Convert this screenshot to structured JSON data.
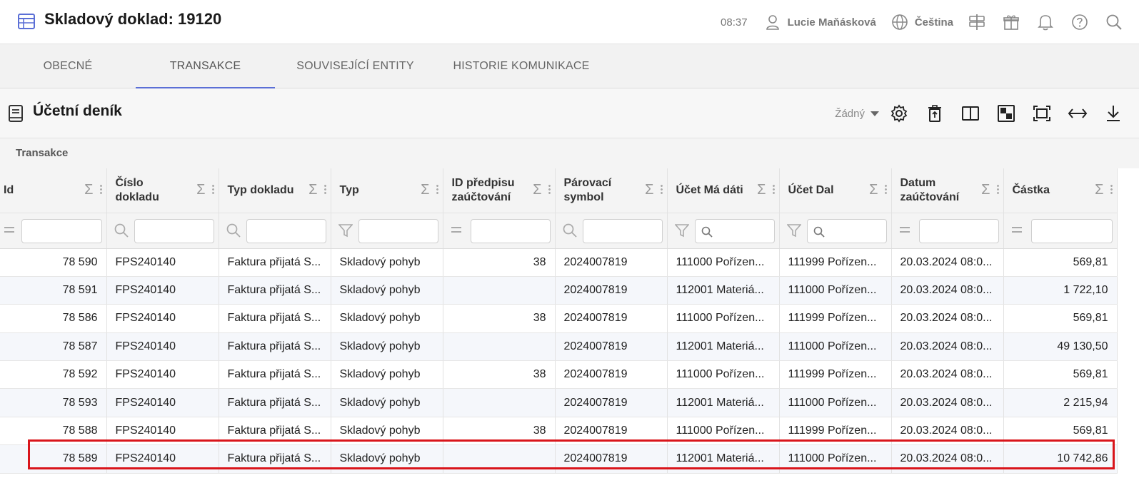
{
  "header": {
    "title": "Skladový doklad: 19120",
    "time": "08:37",
    "user": "Lucie Maňásková",
    "language": "Čeština"
  },
  "tabs": [
    {
      "label": "OBECNÉ",
      "active": false
    },
    {
      "label": "TRANSAKCE",
      "active": true
    },
    {
      "label": "SOUVISEJÍCÍ ENTITY",
      "active": false
    },
    {
      "label": "HISTORIE KOMUNIKACE",
      "active": false
    }
  ],
  "section": {
    "title": "Účetní deník",
    "select_value": "Žádný"
  },
  "grid": {
    "caption": "Transakce",
    "columns": [
      {
        "label": "Id"
      },
      {
        "label": "Číslo dokladu"
      },
      {
        "label": "Typ dokladu"
      },
      {
        "label": "Typ"
      },
      {
        "label": "ID předpisu zaúčtování"
      },
      {
        "label": "Párovací symbol"
      },
      {
        "label": "Účet Má dáti"
      },
      {
        "label": "Účet Dal"
      },
      {
        "label": "Datum zaúčtování"
      },
      {
        "label": "Částka"
      }
    ],
    "filter_icons": [
      "equals-icon",
      "search-icon",
      "search-icon",
      "filter-icon",
      "equals-icon",
      "search-icon",
      "filter-icon",
      "filter-icon",
      "equals-icon",
      "equals-icon"
    ],
    "rows": [
      [
        "78 590",
        "FPS240140",
        "Faktura přijatá S...",
        "Skladový pohyb",
        "38",
        "2024007819",
        "111000 Pořízen...",
        "111999 Pořízen...",
        "20.03.2024 08:0...",
        "569,81"
      ],
      [
        "78 591",
        "FPS240140",
        "Faktura přijatá S...",
        "Skladový pohyb",
        "",
        "2024007819",
        "112001 Materiá...",
        "111000 Pořízen...",
        "20.03.2024 08:0...",
        "1 722,10"
      ],
      [
        "78 586",
        "FPS240140",
        "Faktura přijatá S...",
        "Skladový pohyb",
        "38",
        "2024007819",
        "111000 Pořízen...",
        "111999 Pořízen...",
        "20.03.2024 08:0...",
        "569,81"
      ],
      [
        "78 587",
        "FPS240140",
        "Faktura přijatá S...",
        "Skladový pohyb",
        "",
        "2024007819",
        "112001 Materiá...",
        "111000 Pořízen...",
        "20.03.2024 08:0...",
        "49 130,50"
      ],
      [
        "78 592",
        "FPS240140",
        "Faktura přijatá S...",
        "Skladový pohyb",
        "38",
        "2024007819",
        "111000 Pořízen...",
        "111999 Pořízen...",
        "20.03.2024 08:0...",
        "569,81"
      ],
      [
        "78 593",
        "FPS240140",
        "Faktura přijatá S...",
        "Skladový pohyb",
        "",
        "2024007819",
        "112001 Materiá...",
        "111000 Pořízen...",
        "20.03.2024 08:0...",
        "2 215,94"
      ],
      [
        "78 588",
        "FPS240140",
        "Faktura přijatá S...",
        "Skladový pohyb",
        "38",
        "2024007819",
        "111000 Pořízen...",
        "111999 Pořízen...",
        "20.03.2024 08:0...",
        "569,81"
      ],
      [
        "78 589",
        "FPS240140",
        "Faktura přijatá S...",
        "Skladový pohyb",
        "",
        "2024007819",
        "112001 Materiá...",
        "111000 Pořízen...",
        "20.03.2024 08:0...",
        "10 742,86"
      ]
    ]
  },
  "colors": {
    "accent": "#5b6fd6",
    "link": "#4f63d2",
    "highlight": "#d9151b"
  }
}
